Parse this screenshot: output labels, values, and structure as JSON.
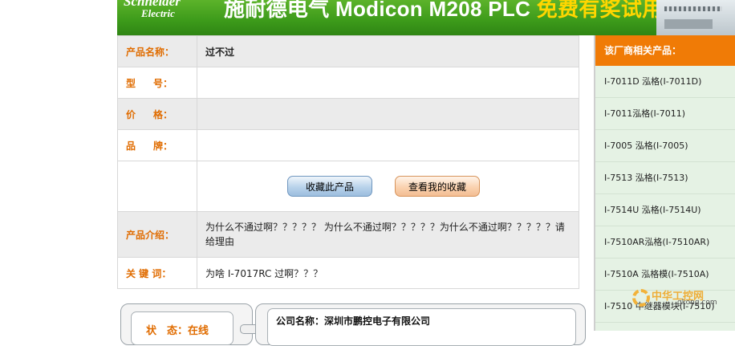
{
  "banner": {
    "brand_line1": "Schneider",
    "brand_line2": "Electric",
    "title_main": "施耐德电气 Modicon M208 PLC ",
    "title_promo": "免费有奖试用"
  },
  "product": {
    "name_label": "产品名称：",
    "name_value": "过不过",
    "model_label_a": "型",
    "model_label_b": "号：",
    "model_value": "",
    "price_label_a": "价",
    "price_label_b": "格：",
    "price_value": "",
    "brand_label_a": "品",
    "brand_label_b": "牌：",
    "brand_value": "",
    "favorite_button": "收藏此产品",
    "my_favorites_button": "查看我的收藏",
    "intro_label": "产品介绍：",
    "intro_value": "为什么不通过啊？？？？？ 为什么不通过啊？？？？？为什么不通过啊？？？？？请给理由",
    "keywords_label": "关 键 词：",
    "keywords_value": "为啥 I-7017RC 过啊？？？"
  },
  "sidebar": {
    "header": "该厂商相关产品：",
    "items": [
      "I-7011D 泓格(I-7011D)",
      "I-7011泓格(I-7011)",
      "I-7005 泓格(I-7005)",
      "I-7513 泓格(I-7513)",
      "I-7514U 泓格(I-7514U)",
      "I-7510AR泓格(I-7510AR)",
      "I-7510A 泓格模(I-7510A)",
      "I-7510 中继器模块(I-7510)"
    ]
  },
  "watermark": {
    "text_cn": "中华工控网",
    "text_url": "gkong.com"
  },
  "status": {
    "label": "状　态：",
    "value": "在线"
  },
  "company": {
    "label": "公司名称：",
    "value": "深圳市鹏控电子有限公司"
  }
}
